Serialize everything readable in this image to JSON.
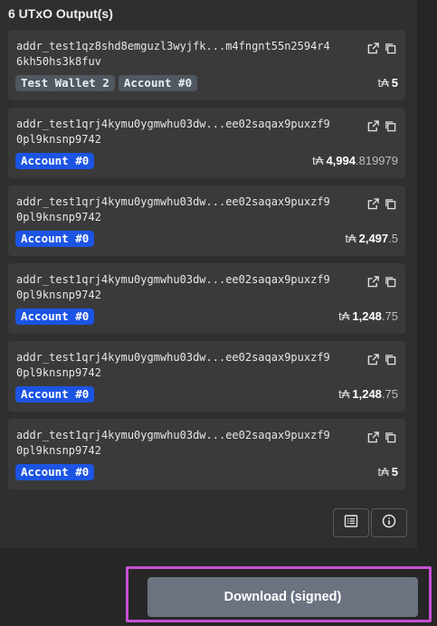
{
  "header": {
    "title": "6 UTxO Output(s)"
  },
  "outputs": [
    {
      "address_line1": "addr_test1qz8shd8emguzl3wyjfk...m4fngnt55n2594r4",
      "address_line2": "6kh50hs3k8fuv",
      "tags": [
        {
          "label": "Test Wallet 2",
          "style": "neutral"
        },
        {
          "label": "Account #0",
          "style": "neutral"
        }
      ],
      "amount_symbol": "t₳",
      "amount_int": "5",
      "amount_frac": ""
    },
    {
      "address_line1": "addr_test1qrj4kymu0ygmwhu03dw...ee02saqax9puxzf9",
      "address_line2": "0pl9knsnp9742",
      "tags": [
        {
          "label": "Account #0",
          "style": "blue"
        }
      ],
      "amount_symbol": "t₳",
      "amount_int": "4,994",
      "amount_frac": ".819979"
    },
    {
      "address_line1": "addr_test1qrj4kymu0ygmwhu03dw...ee02saqax9puxzf9",
      "address_line2": "0pl9knsnp9742",
      "tags": [
        {
          "label": "Account #0",
          "style": "blue"
        }
      ],
      "amount_symbol": "t₳",
      "amount_int": "2,497",
      "amount_frac": ".5"
    },
    {
      "address_line1": "addr_test1qrj4kymu0ygmwhu03dw...ee02saqax9puxzf9",
      "address_line2": "0pl9knsnp9742",
      "tags": [
        {
          "label": "Account #0",
          "style": "blue"
        }
      ],
      "amount_symbol": "t₳",
      "amount_int": "1,248",
      "amount_frac": ".75"
    },
    {
      "address_line1": "addr_test1qrj4kymu0ygmwhu03dw...ee02saqax9puxzf9",
      "address_line2": "0pl9knsnp9742",
      "tags": [
        {
          "label": "Account #0",
          "style": "blue"
        }
      ],
      "amount_symbol": "t₳",
      "amount_int": "1,248",
      "amount_frac": ".75"
    },
    {
      "address_line1": "addr_test1qrj4kymu0ygmwhu03dw...ee02saqax9puxzf9",
      "address_line2": "0pl9knsnp9742",
      "tags": [
        {
          "label": "Account #0",
          "style": "blue"
        }
      ],
      "amount_symbol": "t₳",
      "amount_int": "5",
      "amount_frac": ""
    }
  ],
  "icons": {
    "open": "external-link-icon",
    "copy": "copy-icon",
    "list": "list-icon",
    "info": "info-icon"
  },
  "download": {
    "label": "Download (signed)"
  },
  "colors": {
    "blue_tag": "#1c54e3",
    "neutral_tag": "#505861",
    "download_button": "#6b7280",
    "highlight_border": "#c84fd6"
  }
}
